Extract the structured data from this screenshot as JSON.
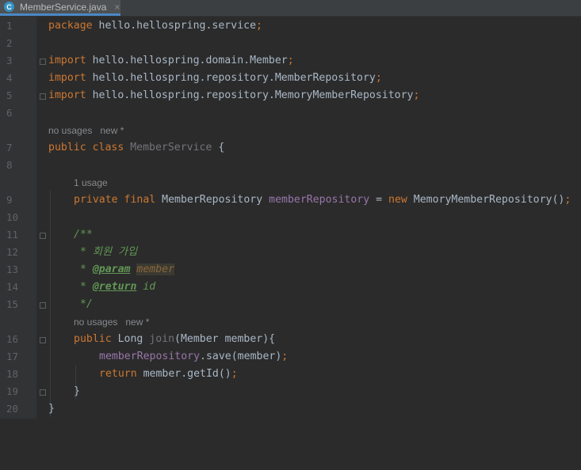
{
  "tab": {
    "icon": "C",
    "filename": "MemberService.java",
    "close": "×"
  },
  "hints": {
    "h1": "no usages   new *",
    "h2": "1 usage",
    "h3": "no usages   new *"
  },
  "lines": {
    "l1": {
      "num": "1",
      "t1": "package",
      "t2": " hello.hellospring.service",
      "t3": ";"
    },
    "l2": {
      "num": "2"
    },
    "l3": {
      "num": "3",
      "t1": "import",
      "t2": " hello.hellospring.domain.Member",
      "t3": ";"
    },
    "l4": {
      "num": "4",
      "t1": "import",
      "t2": " hello.hellospring.repository.MemberRepository",
      "t3": ";"
    },
    "l5": {
      "num": "5",
      "t1": "import",
      "t2": " hello.hellospring.repository.MemoryMemberRepository",
      "t3": ";"
    },
    "l6": {
      "num": "6"
    },
    "l7": {
      "num": "7",
      "t1": "public class",
      "t2": " MemberService",
      "t3": " {"
    },
    "l8": {
      "num": "8"
    },
    "l9": {
      "num": "9",
      "t1": "private final",
      "t2": " MemberRepository ",
      "t3": "memberRepository",
      "t4": " = ",
      "t5": "new",
      "t6": " MemoryMemberRepository()",
      "t7": ";"
    },
    "l10": {
      "num": "10"
    },
    "l11": {
      "num": "11",
      "t1": "/**"
    },
    "l12": {
      "num": "12",
      "t1": " * 회원 가입"
    },
    "l13": {
      "num": "13",
      "t1": " * ",
      "t2": "@param",
      "t3": " ",
      "t4": "member"
    },
    "l14": {
      "num": "14",
      "t1": " * ",
      "t2": "@return",
      "t3": " id"
    },
    "l15": {
      "num": "15",
      "t1": " */"
    },
    "l16": {
      "num": "16",
      "t1": "public",
      "t2": " Long ",
      "t3": "join",
      "t4": "(Member member){"
    },
    "l17": {
      "num": "17",
      "t1": "memberRepository",
      "t2": ".save(member)",
      "t3": ";"
    },
    "l18": {
      "num": "18",
      "t1": "return",
      "t2": " member.getId()",
      "t3": ";"
    },
    "l19": {
      "num": "19",
      "t1": "}"
    },
    "l20": {
      "num": "20",
      "t1": "}"
    }
  }
}
